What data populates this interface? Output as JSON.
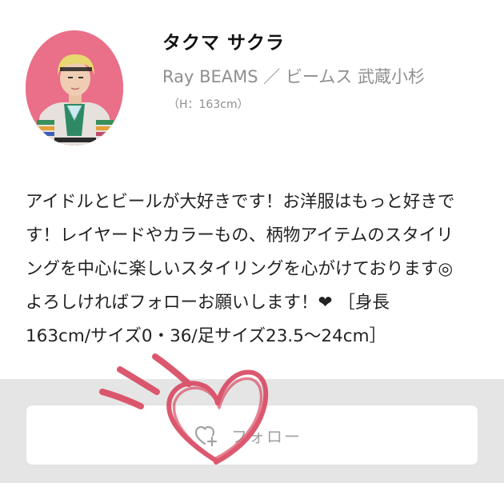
{
  "profile": {
    "name": "タクマ サクラ",
    "shop": "Ray BEAMS ／ ビームス 武蔵小杉",
    "height": "（H：163cm）",
    "avatar_alt": "avatar"
  },
  "bio": {
    "lines": [
      "アイドルとビールが大好きです！お洋服はもっと好きで",
      "す！レイヤードやカラーもの、柄物アイテムのスタイリ",
      "ングを中心に楽しいスタイリングを心がけております◎",
      "よろしければフォローお願いします！❤ ［身長",
      "163cm/サイズ0・36/足サイズ23.5〜24cm］"
    ]
  },
  "follow": {
    "label": "フォロー",
    "icon": "heart-plus-icon"
  },
  "colors": {
    "avatar_bg": "#ea6f88",
    "follow_area_bg": "#e5e5e5",
    "doodle": "#d94a63",
    "muted_text": "#8f8f8f"
  }
}
